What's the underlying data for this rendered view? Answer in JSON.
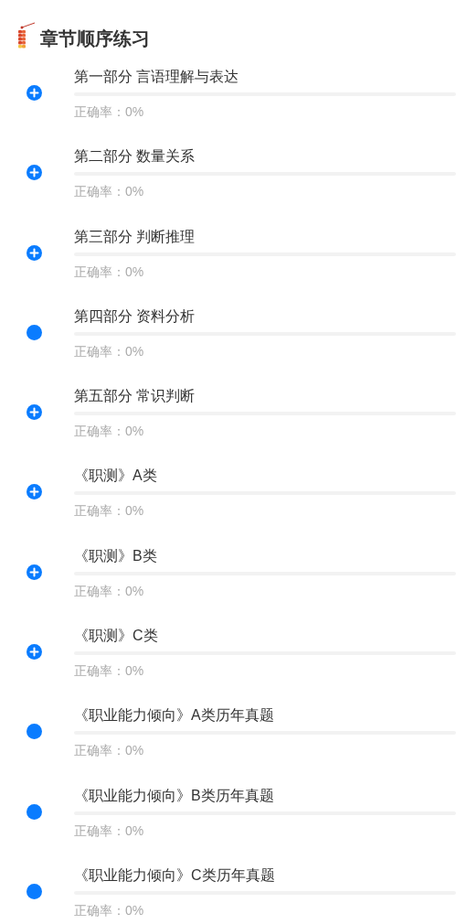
{
  "header": {
    "title": "章节顺序练习"
  },
  "chapters": [
    {
      "title": "第一部分 言语理解与表达",
      "expandable": true,
      "level": 0,
      "accuracy": "正确率：0%"
    },
    {
      "title": "第二部分 数量关系",
      "expandable": true,
      "level": 0,
      "accuracy": "正确率：0%"
    },
    {
      "title": "第三部分 判断推理",
      "expandable": true,
      "level": 0,
      "accuracy": "正确率：0%"
    },
    {
      "title": "第四部分 资料分析",
      "expandable": false,
      "level": 0,
      "accuracy": "正确率：0%"
    },
    {
      "title": "第五部分 常识判断",
      "expandable": true,
      "level": 0,
      "accuracy": "正确率：0%"
    },
    {
      "title": "《职测》A类",
      "expandable": true,
      "level": 0,
      "accuracy": "正确率：0%"
    },
    {
      "title": "《职测》B类",
      "expandable": true,
      "level": 0,
      "accuracy": "正确率：0%"
    },
    {
      "title": "《职测》C类",
      "expandable": true,
      "level": 0,
      "accuracy": "正确率：0%"
    },
    {
      "title": "《职业能力倾向》A类历年真题",
      "expandable": false,
      "level": 0,
      "accuracy": "正确率：0%"
    },
    {
      "title": "《职业能力倾向》B类历年真题",
      "expandable": false,
      "level": 0,
      "accuracy": "正确率：0%"
    },
    {
      "title": "《职业能力倾向》C类历年真题",
      "expandable": false,
      "level": 0,
      "accuracy": "正确率：0%"
    }
  ]
}
